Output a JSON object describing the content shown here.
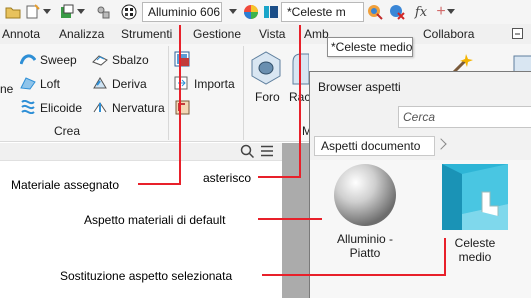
{
  "quick_access": {
    "material_combo": "Alluminio 606",
    "appearance_combo": "*Celeste m"
  },
  "ribbon": {
    "tabs": [
      "Annota",
      "Analizza",
      "Strumenti",
      "Gestione",
      "Vista",
      "Amb",
      "Collabora"
    ],
    "create_panel": {
      "left_cut": "ne",
      "col1": [
        "Sweep",
        "Loft",
        "Elicoide"
      ],
      "col2": [
        "Sbalzo",
        "Deriva",
        "Nervatura"
      ],
      "label": "Crea"
    },
    "importa_label": "Importa",
    "foro_label": "Foro",
    "rac_label": "Rac",
    "m_label": "M"
  },
  "tooltip": "*Celeste medio",
  "browser": {
    "title": "Browser aspetti",
    "search_placeholder": "Cerca",
    "breadcrumb": "Aspetti documento",
    "tiles": [
      {
        "label": "Alluminio - Piatto"
      },
      {
        "label": "Celeste medio"
      }
    ]
  },
  "annotations": {
    "materiale_assegnato": "Materiale assegnato",
    "asterisco": "asterisco",
    "aspetto_default": "Aspetto materiali di default",
    "sostituzione": "Sostituzione aspetto selezionata"
  },
  "colors": {
    "annotation_line": "#e8202a",
    "accent_blue": "#1aa5c9"
  }
}
